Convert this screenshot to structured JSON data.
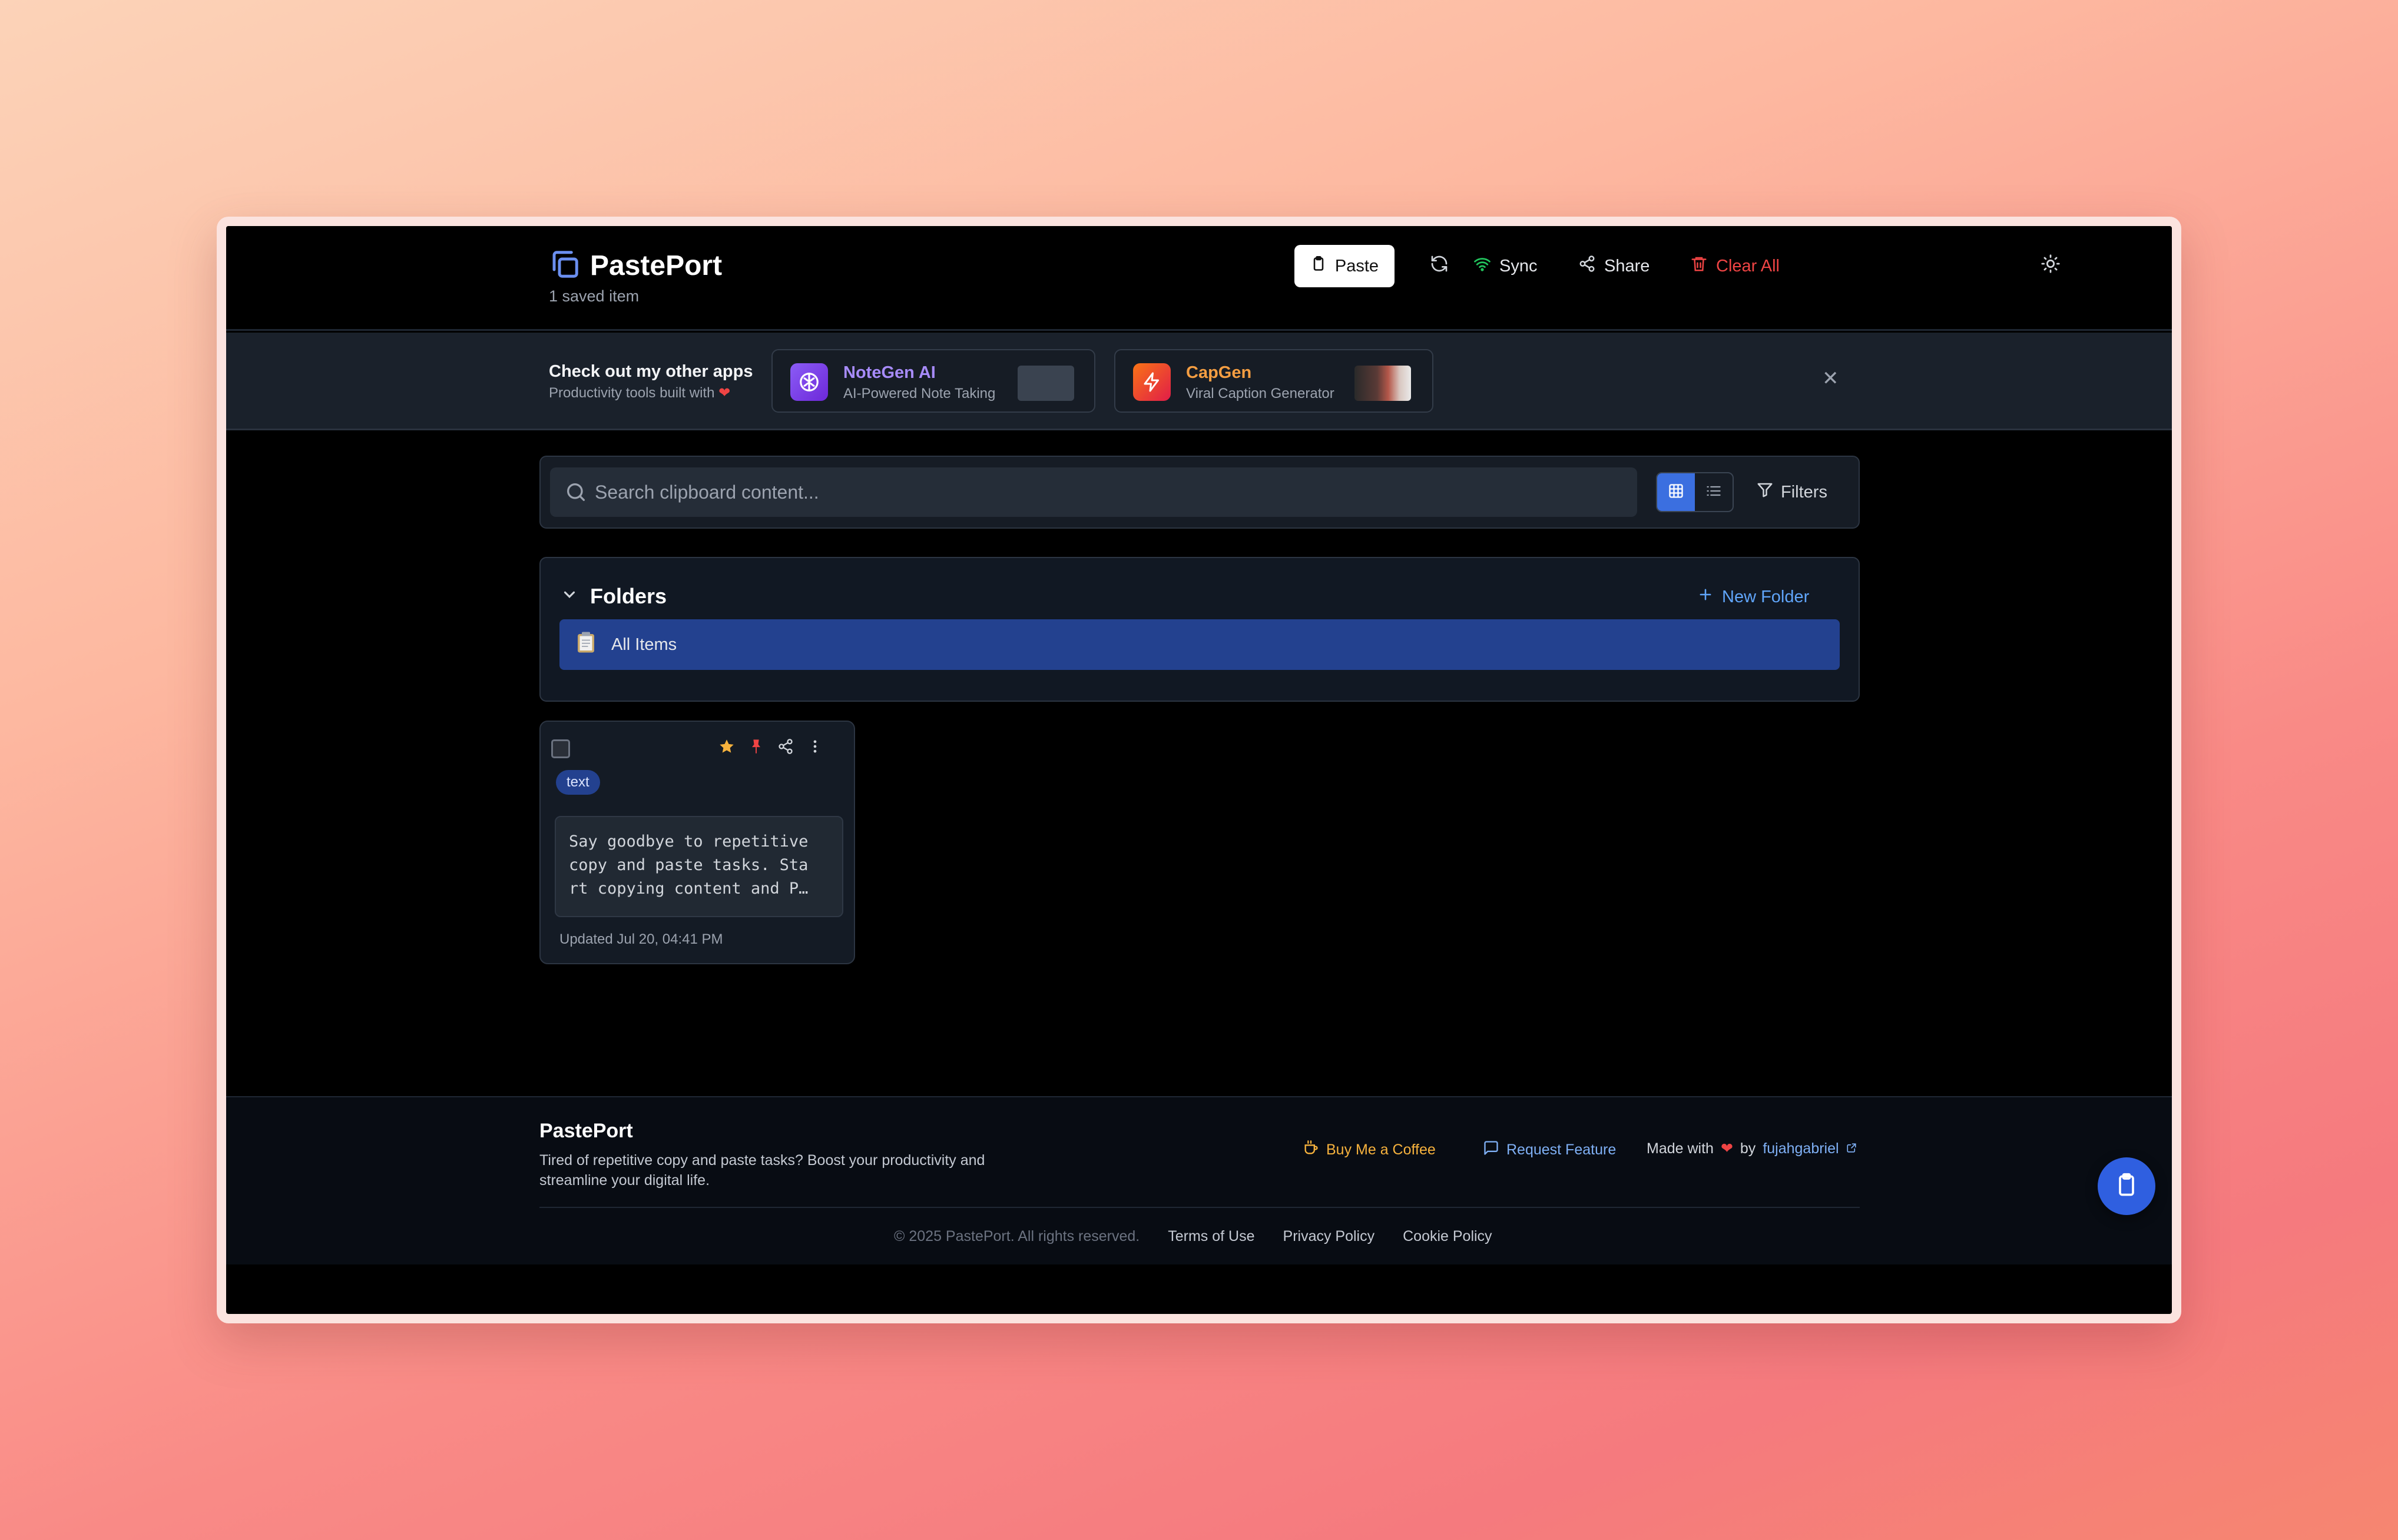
{
  "app": {
    "title": "PastePort",
    "saved_count": "1 saved item"
  },
  "header": {
    "paste_label": "Paste",
    "sync_label": "Sync",
    "share_label": "Share",
    "clear_label": "Clear All"
  },
  "promo": {
    "title": "Check out my other apps",
    "subtitle": "Productivity tools built with",
    "apps": [
      {
        "name": "NoteGen AI",
        "desc": "AI-Powered Note Taking",
        "color": "#a78bfa"
      },
      {
        "name": "CapGen",
        "desc": "Viral Caption Generator",
        "color": "#f59e42"
      }
    ]
  },
  "search": {
    "placeholder": "Search clipboard content...",
    "filters_label": "Filters",
    "view_mode": "grid"
  },
  "folders": {
    "title": "Folders",
    "new_folder_label": "New Folder",
    "items": [
      {
        "label": "All Items",
        "selected": true
      }
    ]
  },
  "clips": [
    {
      "type": "text",
      "content": "Say goodbye to repetitive\ncopy and paste tasks. Sta\nrt copying content and P…",
      "updated": "Updated Jul 20, 04:41 PM",
      "starred": true,
      "pinned": true
    }
  ],
  "footer": {
    "name": "PastePort",
    "description": "Tired of repetitive copy and paste tasks? Boost your productivity and streamline your digital life.",
    "coffee_label": "Buy Me a Coffee",
    "feature_label": "Request Feature",
    "made_with": "Made with",
    "by": "by",
    "author": "fujahgabriel",
    "copyright": "© 2025 PastePort. All rights reserved.",
    "terms": "Terms of Use",
    "privacy": "Privacy Policy",
    "cookie": "Cookie Policy"
  },
  "colors": {
    "accent": "#3b6fe0",
    "danger": "#ef4444",
    "star": "#f6b23d",
    "pin": "#ef4444"
  }
}
